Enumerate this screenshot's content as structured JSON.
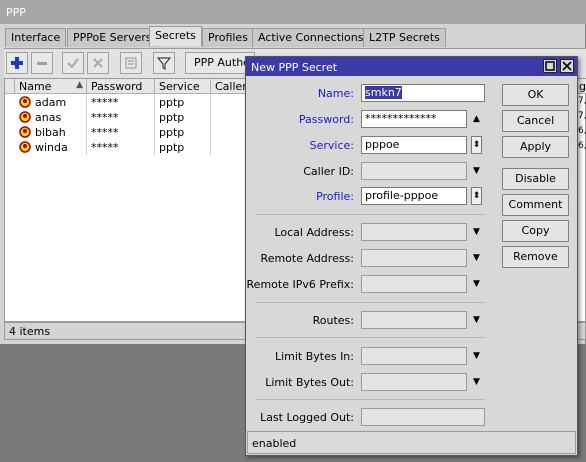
{
  "window": {
    "title": "PPP"
  },
  "tabs": [
    {
      "label": "Interface"
    },
    {
      "label": "PPPoE Servers"
    },
    {
      "label": "Secrets"
    },
    {
      "label": "Profiles"
    },
    {
      "label": "Active Connections"
    },
    {
      "label": "L2TP Secrets"
    }
  ],
  "toolbar": {
    "auth_button_label": "PPP Authe"
  },
  "table": {
    "columns": [
      "Name",
      "Password",
      "Service",
      "Caller"
    ],
    "rows": [
      {
        "name": "adam",
        "password": "*****",
        "service": "pptp",
        "extra": "7,"
      },
      {
        "name": "anas",
        "password": "*****",
        "service": "pptp",
        "extra": "7,"
      },
      {
        "name": "bibah",
        "password": "*****",
        "service": "pptp",
        "extra": "6,"
      },
      {
        "name": "winda",
        "password": "*****",
        "service": "pptp",
        "extra": "6,"
      }
    ],
    "extra_header": "g"
  },
  "status": {
    "items": "4 items"
  },
  "dialog": {
    "title": "New PPP Secret",
    "fields": {
      "name": {
        "label": "Name:",
        "value": "smkn7"
      },
      "password": {
        "label": "Password:",
        "value": "*************"
      },
      "service": {
        "label": "Service:",
        "value": "pppoe"
      },
      "caller_id": {
        "label": "Caller ID:",
        "value": ""
      },
      "profile": {
        "label": "Profile:",
        "value": "profile-pppoe"
      },
      "local_address": {
        "label": "Local Address:",
        "value": ""
      },
      "remote_address": {
        "label": "Remote Address:",
        "value": ""
      },
      "remote_ipv6_prefix": {
        "label": "Remote IPv6 Prefix:",
        "value": ""
      },
      "routes": {
        "label": "Routes:",
        "value": ""
      },
      "limit_bytes_in": {
        "label": "Limit Bytes In:",
        "value": ""
      },
      "limit_bytes_out": {
        "label": "Limit Bytes Out:",
        "value": ""
      },
      "last_logged_out": {
        "label": "Last Logged Out:",
        "value": ""
      }
    },
    "buttons": {
      "ok": "OK",
      "cancel": "Cancel",
      "apply": "Apply",
      "disable": "Disable",
      "comment": "Comment",
      "copy": "Copy",
      "remove": "Remove"
    },
    "status": "enabled"
  },
  "colors": {
    "dialog_title": "#3a3aa8",
    "required_label": "#1a1acc",
    "add_icon": "#1040c0"
  }
}
